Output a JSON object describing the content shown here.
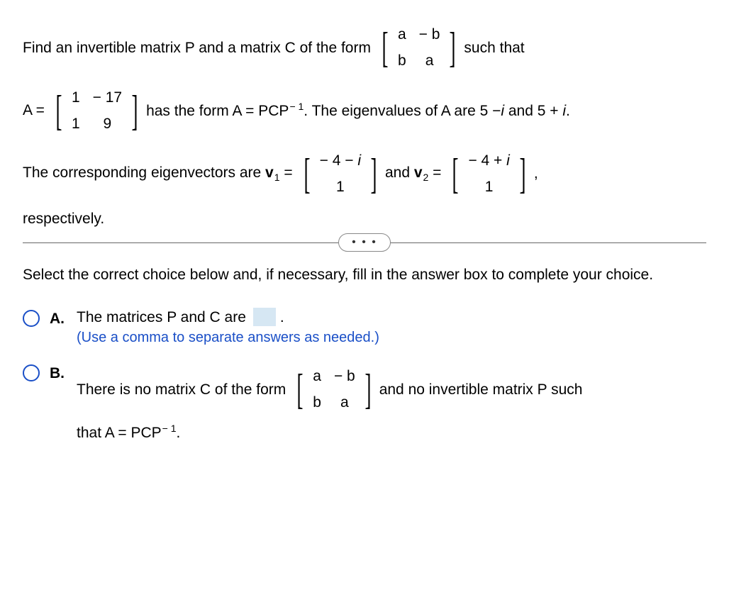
{
  "problem": {
    "intro1": "Find an invertible matrix P and a matrix C of the form",
    "form_matrix": [
      "a",
      "− b",
      "b",
      "a"
    ],
    "intro2": "such that",
    "line2a": "A =",
    "A_matrix": [
      "1",
      "− 17",
      "1",
      "9"
    ],
    "line2b": "has the form A = PCP",
    "exp_neg1": "− 1",
    "line2c": ". The eigenvalues of A are 5 −",
    "i": "i",
    "line2d": " and 5 +",
    "line2e": ".",
    "line3a": "The corresponding eigenvectors are ",
    "v": "v",
    "sub1": "1",
    "eq": " = ",
    "v1_matrix": [
      "− 4 − i",
      "1"
    ],
    "and": " and ",
    "sub2": "2",
    "v2_matrix": [
      "− 4 + i",
      "1"
    ],
    "comma": ",",
    "line4": "respectively."
  },
  "instruction": "Select the correct choice below and, if necessary, fill in the answer box to complete your choice.",
  "choiceA": {
    "label": "A.",
    "text1": "The matrices P and C are ",
    "period": ".",
    "hint": "(Use a comma to separate answers as needed.)"
  },
  "choiceB": {
    "label": "B.",
    "text1": "There is no matrix C of the form",
    "form_matrix": [
      "a",
      "− b",
      "b",
      "a"
    ],
    "text2": "and no invertible matrix P such",
    "text3": "that A = PCP",
    "exp_neg1": "− 1",
    "period": "."
  },
  "ellipsis": "•  •  •"
}
